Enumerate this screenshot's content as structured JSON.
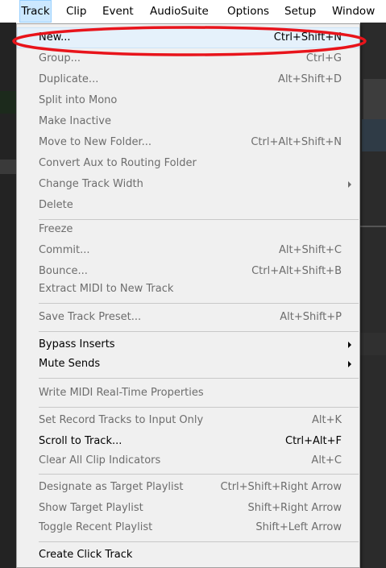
{
  "menubar": {
    "items": [
      "Track",
      "Clip",
      "Event",
      "AudioSuite",
      "Options",
      "Setup",
      "Window"
    ]
  },
  "menu": {
    "items": [
      {
        "label": "New...",
        "shortcut": "Ctrl+Shift+N",
        "enabled": true
      },
      {
        "label": "Group...",
        "shortcut": "Ctrl+G",
        "enabled": false
      },
      {
        "label": "Duplicate...",
        "shortcut": "Alt+Shift+D",
        "enabled": false
      },
      {
        "label": "Split into Mono",
        "shortcut": "",
        "enabled": false
      },
      {
        "label": "Make Inactive",
        "shortcut": "",
        "enabled": false
      },
      {
        "label": "Move to New Folder...",
        "shortcut": "Ctrl+Alt+Shift+N",
        "enabled": false
      },
      {
        "label": "Convert Aux to Routing Folder",
        "shortcut": "",
        "enabled": false
      },
      {
        "label": "Change Track Width",
        "shortcut": "",
        "enabled": false
      },
      {
        "label": "Delete",
        "shortcut": "",
        "enabled": false
      },
      {
        "label": "Freeze",
        "shortcut": "",
        "enabled": false
      },
      {
        "label": "Commit...",
        "shortcut": "Alt+Shift+C",
        "enabled": false
      },
      {
        "label": "Bounce...",
        "shortcut": "Ctrl+Alt+Shift+B",
        "enabled": false
      },
      {
        "label": "Extract MIDI to New Track",
        "shortcut": "",
        "enabled": false
      },
      {
        "label": "Save Track Preset...",
        "shortcut": "Alt+Shift+P",
        "enabled": false
      },
      {
        "label": "Bypass Inserts",
        "shortcut": "",
        "enabled": true
      },
      {
        "label": "Mute Sends",
        "shortcut": "",
        "enabled": true
      },
      {
        "label": "Write MIDI Real-Time Properties",
        "shortcut": "",
        "enabled": false
      },
      {
        "label": "Set Record Tracks to Input Only",
        "shortcut": "Alt+K",
        "enabled": false
      },
      {
        "label": "Scroll to Track...",
        "shortcut": "Ctrl+Alt+F",
        "enabled": true
      },
      {
        "label": "Clear All Clip Indicators",
        "shortcut": "Alt+C",
        "enabled": false
      },
      {
        "label": "Designate as Target Playlist",
        "shortcut": "Ctrl+Shift+Right Arrow",
        "enabled": false
      },
      {
        "label": "Show Target Playlist",
        "shortcut": "Shift+Right Arrow",
        "enabled": false
      },
      {
        "label": "Toggle Recent Playlist",
        "shortcut": "Shift+Left Arrow",
        "enabled": false
      },
      {
        "label": "Create Click Track",
        "shortcut": "",
        "enabled": true
      }
    ]
  },
  "annotation": {
    "color": "#e8141b"
  },
  "colors": {
    "menu_bg": "#f0f0f0",
    "disabled_text": "#6d6d6d",
    "menubar_active": "#cce8ff"
  }
}
